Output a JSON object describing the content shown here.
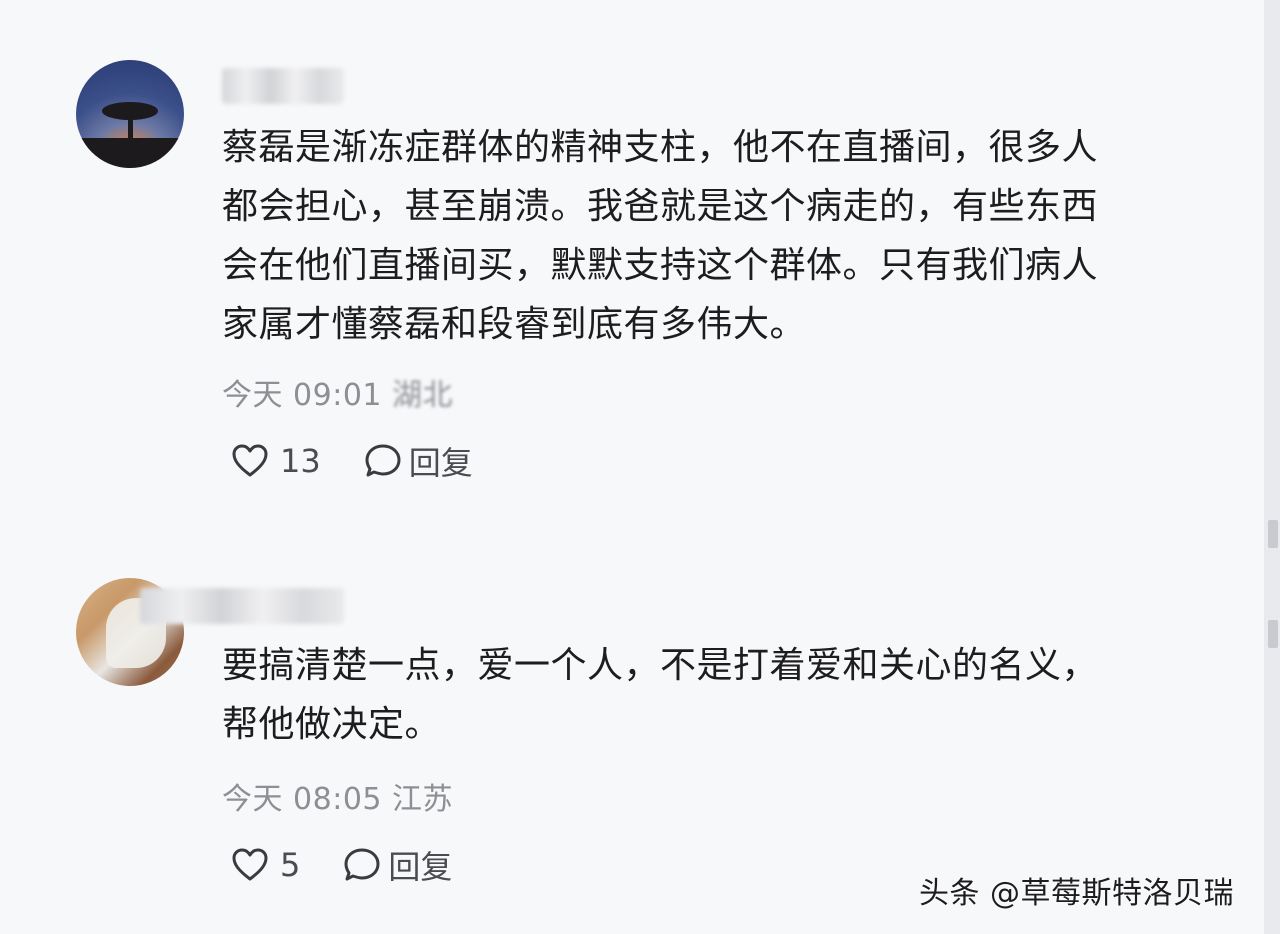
{
  "comments": [
    {
      "text": "蔡磊是渐冻症群体的精神支柱，他不在直播间，很多人\n都会担心，甚至崩溃。我爸就是这个病走的，有些东西\n会在他们直播间买，默默支持这个群体。只有我们病人\n家属才懂蔡磊和段睿到底有多伟大。",
      "time": "今天 09:01",
      "location": "湖北",
      "likes": "13",
      "reply_label": "回复",
      "avatar_icon": "sunset-tree-avatar"
    },
    {
      "text": "要搞清楚一点，爱一个人，不是打着爱和关心的名义，\n帮他做决定。",
      "time": "今天 08:05",
      "location": "江苏",
      "likes": "5",
      "reply_label": "回复",
      "avatar_icon": "photo-avatar"
    }
  ],
  "watermark": "头条 @草莓斯特洛贝瑞",
  "icons": {
    "like": "heart-icon",
    "reply": "speech-bubble-icon"
  },
  "colors": {
    "text": "#1d1d1f",
    "meta": "#8e8f94",
    "action": "#4b4c52",
    "background": "#f7f8fa"
  }
}
